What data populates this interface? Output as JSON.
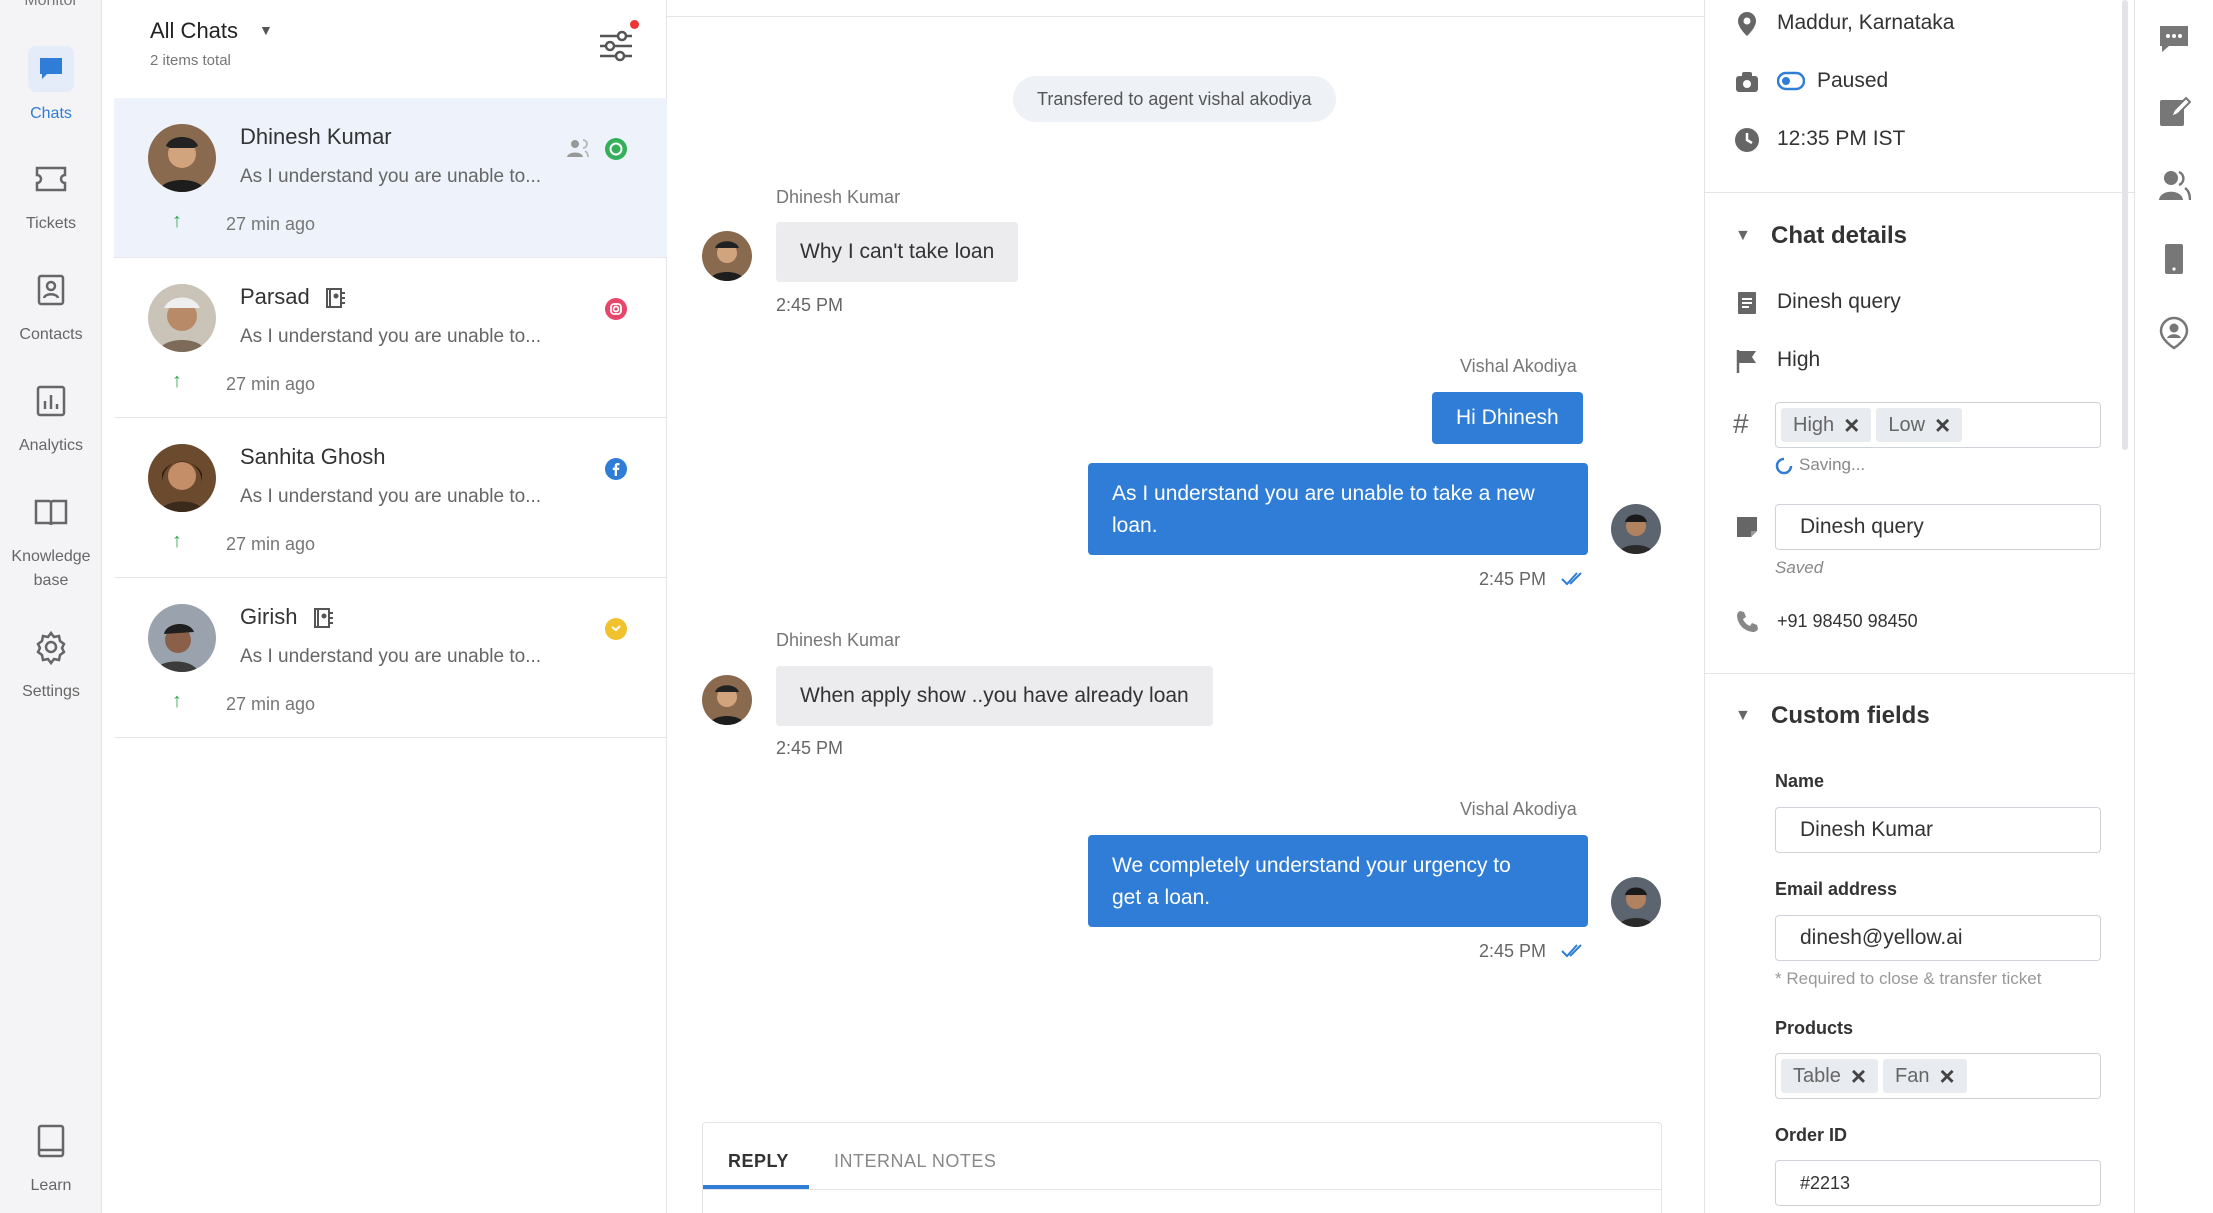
{
  "leftnav": {
    "partial_label": "Monitor",
    "items": [
      {
        "label": "Chats",
        "active": true
      },
      {
        "label": "Tickets"
      },
      {
        "label": "Contacts"
      },
      {
        "label": "Analytics"
      },
      {
        "label_line1": "Knowledge",
        "label_line2": "base"
      },
      {
        "label": "Settings"
      },
      {
        "label": "Learn"
      }
    ]
  },
  "chatlist": {
    "title": "All Chats",
    "count": "2 items total",
    "chats": [
      {
        "name": "Dhinesh Kumar",
        "preview": "As I understand you are unable to...",
        "time": "27 min ago",
        "channel": "whatsapp",
        "channel_color": "#35b05a"
      },
      {
        "name": "Parsad",
        "preview": "As I understand you are unable to...",
        "time": "27 min ago",
        "channel": "instagram",
        "channel_color": "#e8456b"
      },
      {
        "name": "Sanhita Ghosh",
        "preview": "As I understand you are unable to...",
        "time": "27 min ago",
        "channel": "facebook",
        "channel_color": "#2f7dd6"
      },
      {
        "name": "Girish",
        "preview": "As I understand you are unable to...",
        "time": "27 min ago",
        "channel": "yellow",
        "channel_color": "#f2c12e"
      }
    ]
  },
  "conversation": {
    "system_message": "Transfered to agent vishal akodiya",
    "messages": [
      {
        "sender": "Dhinesh Kumar",
        "text": "Why I can't take loan",
        "time": "2:45 PM"
      },
      {
        "sender": "Vishal Akodiya",
        "text1": "Hi Dhinesh",
        "text2_line1": "As I understand you are unable to take a new",
        "text2_line2": "loan.",
        "time": "2:45 PM"
      },
      {
        "sender": "Dhinesh Kumar",
        "text": "When apply show ..you have already loan",
        "time": "2:45 PM"
      },
      {
        "sender": "Vishal Akodiya",
        "text_line1": "We completely understand your urgency to",
        "text_line2": "get a loan.",
        "time": "2:45 PM"
      }
    ],
    "reply_tabs": [
      "REPLY",
      "INTERNAL NOTES"
    ]
  },
  "details": {
    "location": "Maddur, Karnataka",
    "status": "Paused",
    "local_time": "12:35 PM IST",
    "chat_details_title": "Chat details",
    "query": "Dinesh query",
    "priority": "High",
    "tags": [
      "High",
      "Low"
    ],
    "saving_text": "Saving...",
    "note_value": "Dinesh query",
    "saved_text": "Saved",
    "phone": "+91 98450 98450",
    "custom_fields_title": "Custom fields",
    "name_label": "Name",
    "name_value": "Dinesh Kumar",
    "email_label": "Email address",
    "email_value": "dinesh@yellow.ai",
    "email_hint": "* Required to close & transfer ticket",
    "products_label": "Products",
    "products": [
      "Table",
      "Fan"
    ],
    "order_label": "Order ID",
    "order_value": "#2213"
  },
  "colors": {
    "accent": "#2f7dd6",
    "online": "#35a853"
  }
}
